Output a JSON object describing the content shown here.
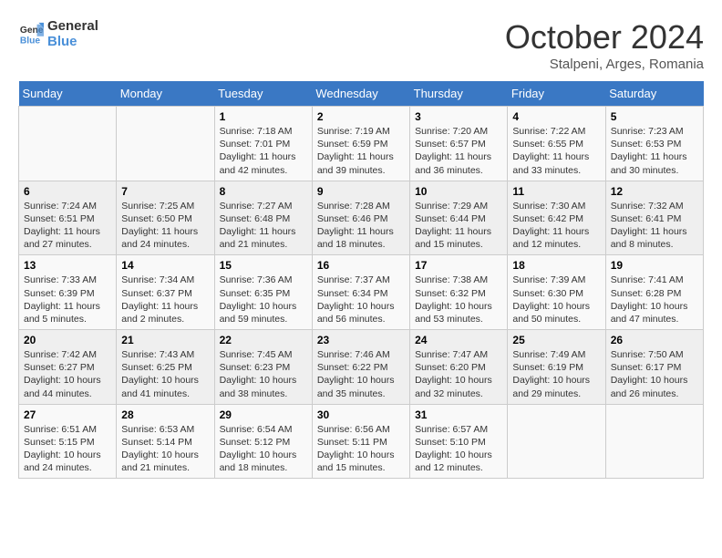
{
  "logo": {
    "line1": "General",
    "line2": "Blue"
  },
  "title": "October 2024",
  "location": "Stalpeni, Arges, Romania",
  "weekdays": [
    "Sunday",
    "Monday",
    "Tuesday",
    "Wednesday",
    "Thursday",
    "Friday",
    "Saturday"
  ],
  "weeks": [
    [
      {
        "day": "",
        "sunrise": "",
        "sunset": "",
        "daylight": ""
      },
      {
        "day": "",
        "sunrise": "",
        "sunset": "",
        "daylight": ""
      },
      {
        "day": "1",
        "sunrise": "Sunrise: 7:18 AM",
        "sunset": "Sunset: 7:01 PM",
        "daylight": "Daylight: 11 hours and 42 minutes."
      },
      {
        "day": "2",
        "sunrise": "Sunrise: 7:19 AM",
        "sunset": "Sunset: 6:59 PM",
        "daylight": "Daylight: 11 hours and 39 minutes."
      },
      {
        "day": "3",
        "sunrise": "Sunrise: 7:20 AM",
        "sunset": "Sunset: 6:57 PM",
        "daylight": "Daylight: 11 hours and 36 minutes."
      },
      {
        "day": "4",
        "sunrise": "Sunrise: 7:22 AM",
        "sunset": "Sunset: 6:55 PM",
        "daylight": "Daylight: 11 hours and 33 minutes."
      },
      {
        "day": "5",
        "sunrise": "Sunrise: 7:23 AM",
        "sunset": "Sunset: 6:53 PM",
        "daylight": "Daylight: 11 hours and 30 minutes."
      }
    ],
    [
      {
        "day": "6",
        "sunrise": "Sunrise: 7:24 AM",
        "sunset": "Sunset: 6:51 PM",
        "daylight": "Daylight: 11 hours and 27 minutes."
      },
      {
        "day": "7",
        "sunrise": "Sunrise: 7:25 AM",
        "sunset": "Sunset: 6:50 PM",
        "daylight": "Daylight: 11 hours and 24 minutes."
      },
      {
        "day": "8",
        "sunrise": "Sunrise: 7:27 AM",
        "sunset": "Sunset: 6:48 PM",
        "daylight": "Daylight: 11 hours and 21 minutes."
      },
      {
        "day": "9",
        "sunrise": "Sunrise: 7:28 AM",
        "sunset": "Sunset: 6:46 PM",
        "daylight": "Daylight: 11 hours and 18 minutes."
      },
      {
        "day": "10",
        "sunrise": "Sunrise: 7:29 AM",
        "sunset": "Sunset: 6:44 PM",
        "daylight": "Daylight: 11 hours and 15 minutes."
      },
      {
        "day": "11",
        "sunrise": "Sunrise: 7:30 AM",
        "sunset": "Sunset: 6:42 PM",
        "daylight": "Daylight: 11 hours and 12 minutes."
      },
      {
        "day": "12",
        "sunrise": "Sunrise: 7:32 AM",
        "sunset": "Sunset: 6:41 PM",
        "daylight": "Daylight: 11 hours and 8 minutes."
      }
    ],
    [
      {
        "day": "13",
        "sunrise": "Sunrise: 7:33 AM",
        "sunset": "Sunset: 6:39 PM",
        "daylight": "Daylight: 11 hours and 5 minutes."
      },
      {
        "day": "14",
        "sunrise": "Sunrise: 7:34 AM",
        "sunset": "Sunset: 6:37 PM",
        "daylight": "Daylight: 11 hours and 2 minutes."
      },
      {
        "day": "15",
        "sunrise": "Sunrise: 7:36 AM",
        "sunset": "Sunset: 6:35 PM",
        "daylight": "Daylight: 10 hours and 59 minutes."
      },
      {
        "day": "16",
        "sunrise": "Sunrise: 7:37 AM",
        "sunset": "Sunset: 6:34 PM",
        "daylight": "Daylight: 10 hours and 56 minutes."
      },
      {
        "day": "17",
        "sunrise": "Sunrise: 7:38 AM",
        "sunset": "Sunset: 6:32 PM",
        "daylight": "Daylight: 10 hours and 53 minutes."
      },
      {
        "day": "18",
        "sunrise": "Sunrise: 7:39 AM",
        "sunset": "Sunset: 6:30 PM",
        "daylight": "Daylight: 10 hours and 50 minutes."
      },
      {
        "day": "19",
        "sunrise": "Sunrise: 7:41 AM",
        "sunset": "Sunset: 6:28 PM",
        "daylight": "Daylight: 10 hours and 47 minutes."
      }
    ],
    [
      {
        "day": "20",
        "sunrise": "Sunrise: 7:42 AM",
        "sunset": "Sunset: 6:27 PM",
        "daylight": "Daylight: 10 hours and 44 minutes."
      },
      {
        "day": "21",
        "sunrise": "Sunrise: 7:43 AM",
        "sunset": "Sunset: 6:25 PM",
        "daylight": "Daylight: 10 hours and 41 minutes."
      },
      {
        "day": "22",
        "sunrise": "Sunrise: 7:45 AM",
        "sunset": "Sunset: 6:23 PM",
        "daylight": "Daylight: 10 hours and 38 minutes."
      },
      {
        "day": "23",
        "sunrise": "Sunrise: 7:46 AM",
        "sunset": "Sunset: 6:22 PM",
        "daylight": "Daylight: 10 hours and 35 minutes."
      },
      {
        "day": "24",
        "sunrise": "Sunrise: 7:47 AM",
        "sunset": "Sunset: 6:20 PM",
        "daylight": "Daylight: 10 hours and 32 minutes."
      },
      {
        "day": "25",
        "sunrise": "Sunrise: 7:49 AM",
        "sunset": "Sunset: 6:19 PM",
        "daylight": "Daylight: 10 hours and 29 minutes."
      },
      {
        "day": "26",
        "sunrise": "Sunrise: 7:50 AM",
        "sunset": "Sunset: 6:17 PM",
        "daylight": "Daylight: 10 hours and 26 minutes."
      }
    ],
    [
      {
        "day": "27",
        "sunrise": "Sunrise: 6:51 AM",
        "sunset": "Sunset: 5:15 PM",
        "daylight": "Daylight: 10 hours and 24 minutes."
      },
      {
        "day": "28",
        "sunrise": "Sunrise: 6:53 AM",
        "sunset": "Sunset: 5:14 PM",
        "daylight": "Daylight: 10 hours and 21 minutes."
      },
      {
        "day": "29",
        "sunrise": "Sunrise: 6:54 AM",
        "sunset": "Sunset: 5:12 PM",
        "daylight": "Daylight: 10 hours and 18 minutes."
      },
      {
        "day": "30",
        "sunrise": "Sunrise: 6:56 AM",
        "sunset": "Sunset: 5:11 PM",
        "daylight": "Daylight: 10 hours and 15 minutes."
      },
      {
        "day": "31",
        "sunrise": "Sunrise: 6:57 AM",
        "sunset": "Sunset: 5:10 PM",
        "daylight": "Daylight: 10 hours and 12 minutes."
      },
      {
        "day": "",
        "sunrise": "",
        "sunset": "",
        "daylight": ""
      },
      {
        "day": "",
        "sunrise": "",
        "sunset": "",
        "daylight": ""
      }
    ]
  ]
}
